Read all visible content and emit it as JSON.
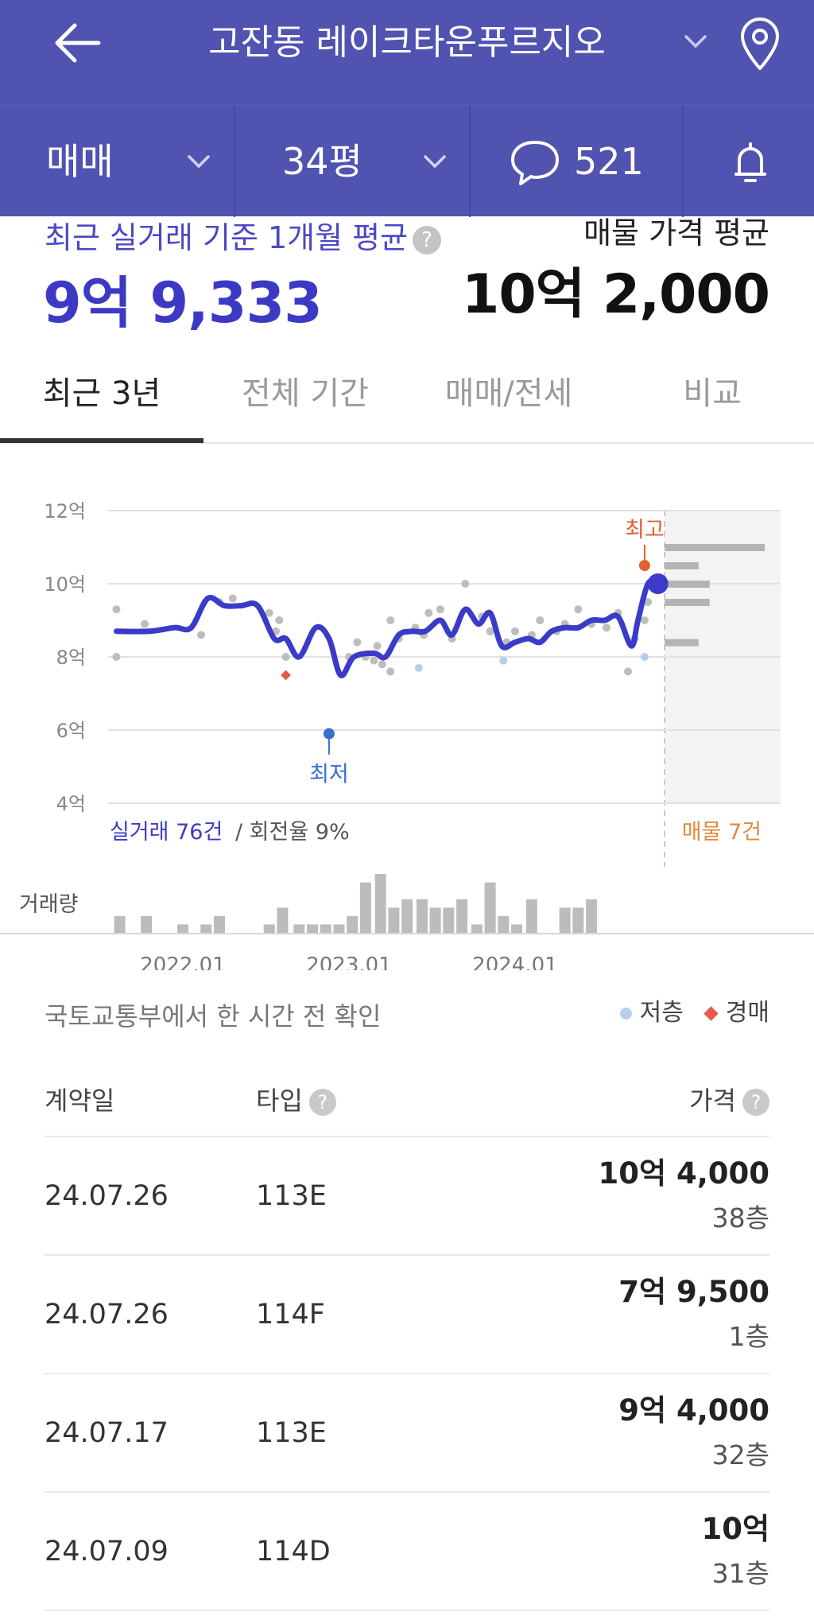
{
  "header": {
    "title": "고잔동 레이크타운푸르지오",
    "icons": {
      "back": "back-arrow-icon",
      "dropdown": "chevron-down-icon",
      "location": "map-pin-icon"
    },
    "bg_color": "#5053b0"
  },
  "filters": {
    "trade_type": "매매",
    "size": "34평",
    "comment_count": "521",
    "icons": {
      "comment": "speech-bubble-icon",
      "alarm": "bell-icon"
    }
  },
  "summary": {
    "recent_avg_label": "최근 실거래 기준 1개월 평균",
    "recent_avg_help": "?",
    "recent_avg_value": "9억 9,333",
    "listing_avg_label": "매물 가격 평균",
    "listing_avg_value": "10억 2,000",
    "accent_color": "#3c3ac4"
  },
  "tabs": [
    {
      "label": "최근 3년",
      "active": true
    },
    {
      "label": "전체 기간",
      "active": false
    },
    {
      "label": "매매/전세",
      "active": false
    },
    {
      "label": "비교",
      "active": false
    }
  ],
  "chart_data": {
    "type": "line",
    "y_ticks": [
      "12억",
      "10억",
      "8억",
      "6억",
      "4억"
    ],
    "ylim": [
      4,
      12
    ],
    "y_unit": "억",
    "x_ticks": [
      "2022.01",
      "2023.01",
      "2024.01"
    ],
    "grid": true,
    "series": [
      {
        "name": "",
        "color": "#3b3bc9",
        "points": [
          [
            2021.6,
            8.7
          ],
          [
            2021.8,
            8.7
          ],
          [
            2021.95,
            8.8
          ],
          [
            2022.05,
            8.8
          ],
          [
            2022.15,
            9.6
          ],
          [
            2022.25,
            9.4
          ],
          [
            2022.35,
            9.4
          ],
          [
            2022.45,
            9.4
          ],
          [
            2022.55,
            8.5
          ],
          [
            2022.62,
            8.5
          ],
          [
            2022.7,
            8.0
          ],
          [
            2022.8,
            8.8
          ],
          [
            2022.88,
            8.5
          ],
          [
            2022.95,
            7.5
          ],
          [
            2023.03,
            8.0
          ],
          [
            2023.15,
            8.1
          ],
          [
            2023.22,
            8.0
          ],
          [
            2023.3,
            8.6
          ],
          [
            2023.38,
            8.7
          ],
          [
            2023.46,
            8.7
          ],
          [
            2023.55,
            9.0
          ],
          [
            2023.62,
            8.6
          ],
          [
            2023.7,
            9.3
          ],
          [
            2023.78,
            8.9
          ],
          [
            2023.85,
            9.2
          ],
          [
            2023.92,
            8.3
          ],
          [
            2024.0,
            8.4
          ],
          [
            2024.08,
            8.5
          ],
          [
            2024.15,
            8.4
          ],
          [
            2024.22,
            8.7
          ],
          [
            2024.3,
            8.8
          ],
          [
            2024.38,
            8.8
          ],
          [
            2024.46,
            9.0
          ],
          [
            2024.54,
            9.0
          ],
          [
            2024.62,
            9.1
          ],
          [
            2024.7,
            8.3
          ],
          [
            2024.74,
            9.0
          ],
          [
            2024.8,
            10.0
          ],
          [
            2024.86,
            10.0
          ]
        ]
      }
    ],
    "transactions": [
      [
        2021.6,
        9.3
      ],
      [
        2021.6,
        8.0
      ],
      [
        2021.77,
        8.9
      ],
      [
        2022.11,
        8.6
      ],
      [
        2022.22,
        9.5
      ],
      [
        2022.3,
        9.6
      ],
      [
        2022.52,
        9.2
      ],
      [
        2022.56,
        8.7
      ],
      [
        2022.58,
        9.0
      ],
      [
        2022.62,
        8.0
      ],
      [
        2023.0,
        8.0
      ],
      [
        2023.05,
        8.4
      ],
      [
        2023.1,
        8.0
      ],
      [
        2023.15,
        7.9
      ],
      [
        2023.17,
        8.3
      ],
      [
        2023.2,
        7.8
      ],
      [
        2023.25,
        7.6
      ],
      [
        2023.25,
        9.0
      ],
      [
        2023.3,
        8.5
      ],
      [
        2023.4,
        8.8
      ],
      [
        2023.45,
        8.6
      ],
      [
        2023.48,
        9.2
      ],
      [
        2023.55,
        9.3
      ],
      [
        2023.62,
        8.5
      ],
      [
        2023.7,
        10.0
      ],
      [
        2023.8,
        9.1
      ],
      [
        2023.85,
        8.7
      ],
      [
        2023.95,
        8.4
      ],
      [
        2024.0,
        8.7
      ],
      [
        2024.1,
        8.6
      ],
      [
        2024.15,
        9.0
      ],
      [
        2024.25,
        8.7
      ],
      [
        2024.3,
        8.9
      ],
      [
        2024.38,
        9.3
      ],
      [
        2024.46,
        8.9
      ],
      [
        2024.55,
        8.8
      ],
      [
        2024.62,
        9.2
      ],
      [
        2024.68,
        7.6
      ],
      [
        2024.72,
        8.5
      ],
      [
        2024.78,
        9.0
      ],
      [
        2024.8,
        9.5
      ]
    ],
    "low_floor_points": [
      [
        2023.42,
        7.7
      ],
      [
        2023.93,
        7.9
      ],
      [
        2024.78,
        8.0
      ]
    ],
    "auction_points": [
      [
        2022.62,
        7.5
      ]
    ],
    "min_marker": {
      "label": "최저",
      "x": 2022.88,
      "y": 5.9
    },
    "max_marker": {
      "label": "최고",
      "x": 2024.78,
      "y": 10.5
    },
    "current_marker": {
      "x": 2024.86,
      "y": 10.0
    },
    "listing_bars": [
      {
        "y": 11.0,
        "len": 1.0
      },
      {
        "y": 10.5,
        "len": 0.34
      },
      {
        "y": 10.0,
        "len": 0.45
      },
      {
        "y": 9.5,
        "len": 0.45
      },
      {
        "y": 8.4,
        "len": 0.34
      }
    ],
    "transaction_count_label": "실거래 76건",
    "turnover_label": "/ 회전율 9%",
    "listing_count_label": "매물 7건",
    "volume_label": "거래량",
    "volume_bars": [
      [
        2021.62,
        2
      ],
      [
        2021.78,
        2
      ],
      [
        2022.0,
        1
      ],
      [
        2022.14,
        1
      ],
      [
        2022.22,
        2
      ],
      [
        2022.52,
        1
      ],
      [
        2022.6,
        3
      ],
      [
        2022.7,
        1
      ],
      [
        2022.78,
        1
      ],
      [
        2022.86,
        1
      ],
      [
        2022.94,
        1
      ],
      [
        2023.02,
        2
      ],
      [
        2023.1,
        6
      ],
      [
        2023.19,
        7
      ],
      [
        2023.27,
        3
      ],
      [
        2023.35,
        4
      ],
      [
        2023.44,
        4
      ],
      [
        2023.52,
        3
      ],
      [
        2023.6,
        3
      ],
      [
        2023.68,
        4
      ],
      [
        2023.77,
        1
      ],
      [
        2023.85,
        6
      ],
      [
        2023.93,
        2
      ],
      [
        2024.01,
        1
      ],
      [
        2024.1,
        4
      ],
      [
        2024.3,
        3
      ],
      [
        2024.38,
        3
      ],
      [
        2024.46,
        4
      ]
    ],
    "volume_max": 7,
    "colors": {
      "line": "#3b3bc9",
      "max": "#e0612f",
      "min": "#3a6fd0",
      "listing": "#e08a3c",
      "tx": "#bdbdbd",
      "low_floor": "#b7cdf0",
      "auction": "#e55a4e"
    }
  },
  "source": {
    "text": "국토교통부에서 한 시간 전 확인"
  },
  "legend": {
    "low_floor": "저층",
    "auction": "경매"
  },
  "table": {
    "headers": {
      "date": "계약일",
      "type": "타입",
      "price": "가격",
      "help": "?"
    },
    "rows": [
      {
        "date": "24.07.26",
        "type": "113E",
        "price": "10억 4,000",
        "floor": "38층"
      },
      {
        "date": "24.07.26",
        "type": "114F",
        "price": "7억 9,500",
        "floor": "1층"
      },
      {
        "date": "24.07.17",
        "type": "113E",
        "price": "9억 4,000",
        "floor": "32층"
      },
      {
        "date": "24.07.09",
        "type": "114D",
        "price": "10억",
        "floor": "31층"
      }
    ]
  }
}
